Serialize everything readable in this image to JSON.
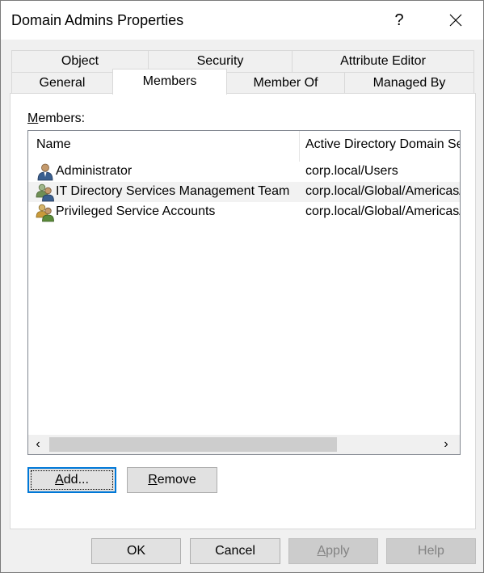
{
  "window": {
    "title": "Domain Admins Properties",
    "help_label": "?"
  },
  "tabs": {
    "row1": [
      {
        "label": "Object"
      },
      {
        "label": "Security"
      },
      {
        "label": "Attribute Editor"
      }
    ],
    "row2": [
      {
        "label": "General"
      },
      {
        "label": "Members",
        "selected": true
      },
      {
        "label": "Member Of"
      },
      {
        "label": "Managed By"
      }
    ]
  },
  "members": {
    "label_prefix": "M",
    "label_rest": "embers:",
    "columns": [
      "Name",
      "Active Directory Domain Se"
    ],
    "rows": [
      {
        "name": "Administrator",
        "path": "corp.local/Users",
        "icon": "user-icon"
      },
      {
        "name": "IT Directory Services Management Team",
        "path": "corp.local/Global/Americas/",
        "icon": "group-icon"
      },
      {
        "name": "Privileged Service Accounts",
        "path": "corp.local/Global/Americas/",
        "icon": "group-icon"
      }
    ],
    "scroll_left": "‹",
    "scroll_right": "›"
  },
  "actions": {
    "add_mnemonic": "A",
    "add_rest": "dd...",
    "remove_mnemonic": "R",
    "remove_rest": "emove"
  },
  "footer": {
    "ok": "OK",
    "cancel": "Cancel",
    "apply_mnemonic": "A",
    "apply_rest": "pply",
    "help": "Help"
  },
  "colors": {
    "accent": "#0078d7",
    "selected_row": "#f2f2f2"
  }
}
